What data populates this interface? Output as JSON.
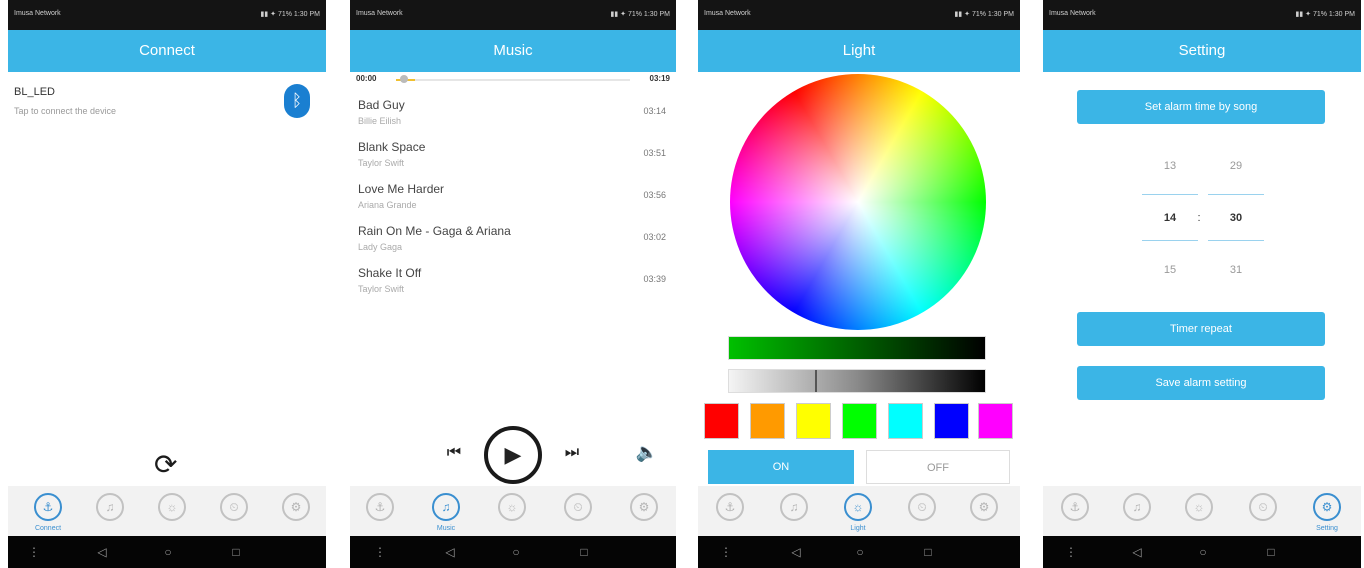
{
  "status": {
    "carrier": "Imusa Network",
    "icons": "▮▮ ✦ 71% 1:30 PM"
  },
  "connect": {
    "title": "Connect",
    "device_name": "BL_LED",
    "device_sub": "Tap to connect the device",
    "refresh_icon": "refresh-icon"
  },
  "music": {
    "title": "Music",
    "time_elapsed": "00:00",
    "time_total": "03:19",
    "progress_fraction": 0.08,
    "songs": [
      {
        "title": "Bad Guy",
        "artist": "Billie Eilish",
        "duration": "03:14"
      },
      {
        "title": "Blank Space",
        "artist": "Taylor Swift",
        "duration": "03:51"
      },
      {
        "title": "Love Me Harder",
        "artist": "Ariana Grande",
        "duration": "03:56"
      },
      {
        "title": "Rain On Me - Gaga & Ariana",
        "artist": "Lady Gaga",
        "duration": "03:02"
      },
      {
        "title": "Shake It Off",
        "artist": "Taylor Swift",
        "duration": "03:39"
      }
    ]
  },
  "light": {
    "title": "Light",
    "swatches": [
      "#ff0000",
      "#ff9a00",
      "#ffff00",
      "#00ff00",
      "#00ffff",
      "#0000ff",
      "#ff00ff"
    ],
    "on_label": "ON",
    "off_label": "OFF",
    "accent": "#3bb5e6"
  },
  "setting": {
    "title": "Setting",
    "btn_top": "Set alarm time by song",
    "picker": [
      {
        "h": "13",
        "m": "29"
      },
      {
        "h": "14",
        "m": "30"
      },
      {
        "h": "15",
        "m": "31"
      }
    ],
    "btn_mid": "Timer repeat",
    "btn_bottom": "Save alarm setting"
  },
  "tabs": [
    "Connect",
    "Music",
    "Light",
    "Timer",
    "Setting"
  ],
  "nav": {
    "back": "◁",
    "home": "○",
    "recent": "□",
    "more": "⋮"
  }
}
